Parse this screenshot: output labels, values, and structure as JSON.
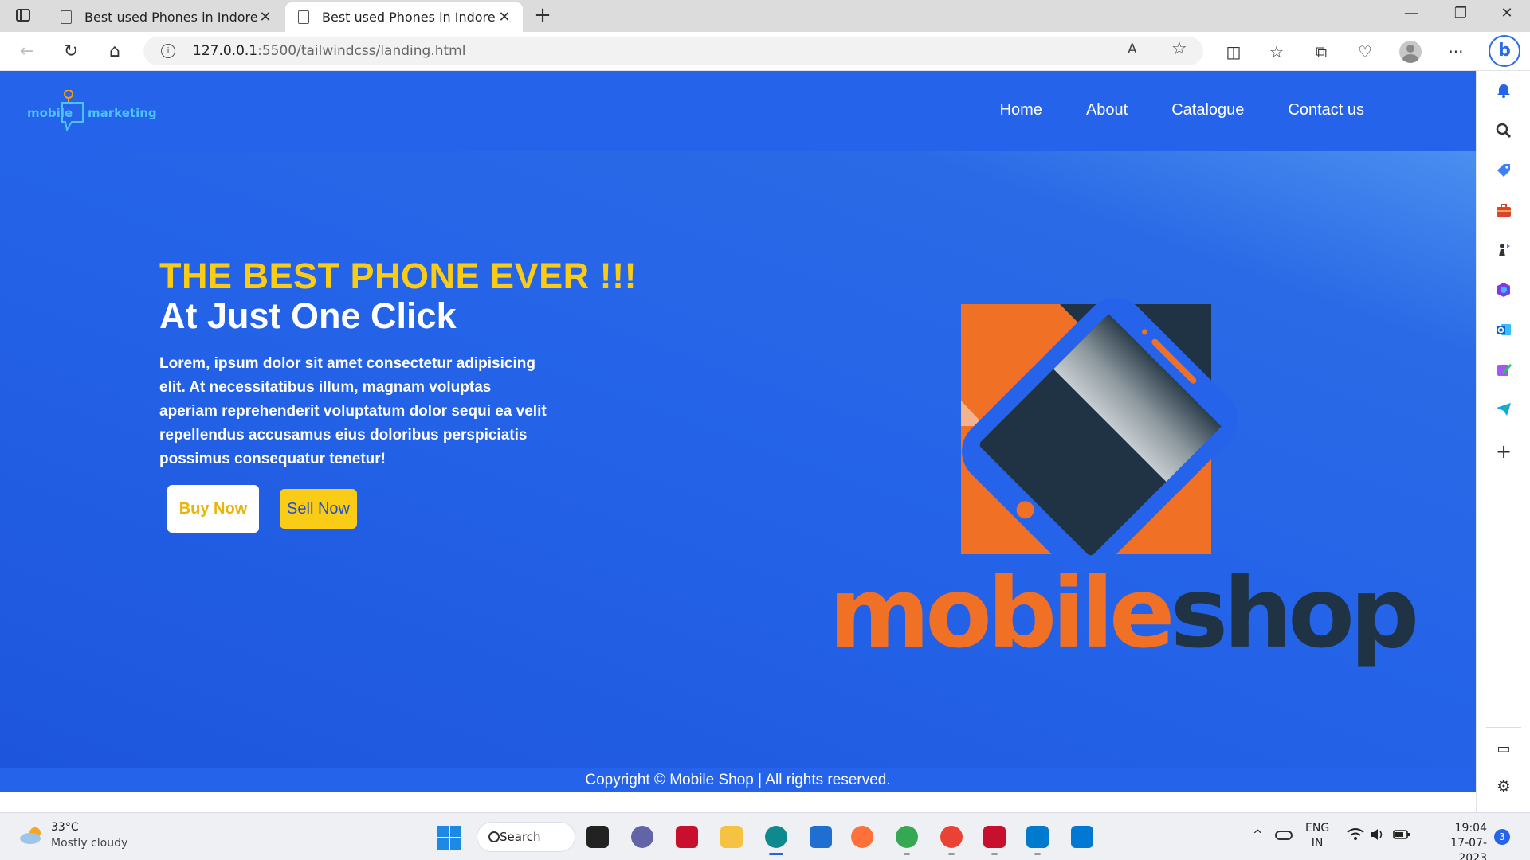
{
  "browser": {
    "tabs": [
      {
        "label": "Best used Phones in Indore",
        "close": "✕"
      },
      {
        "label": "Best used Phones in Indore",
        "close": "✕"
      }
    ],
    "new_tab": "+",
    "window": {
      "minimize": "—",
      "maximize": "❐",
      "close": "✕"
    },
    "nav": {
      "back": "←",
      "reload": "↻",
      "home": "⌂"
    },
    "url": {
      "host": "127.0.0.1",
      "rest": ":5500/tailwindcss/landing.html",
      "info": "i"
    },
    "read_aloud": "A",
    "favorite": "☆",
    "toolbar": {
      "split": "◫",
      "favorites": "☆",
      "collections": "⧉",
      "performance": "♡",
      "menu": "···"
    },
    "bing": "b"
  },
  "sidebar": {
    "icons": [
      "bell-icon",
      "search-icon",
      "shopping-icon",
      "tools-icon",
      "games-icon",
      "microsoft365-icon",
      "outlook-icon",
      "designer-icon",
      "telegram-icon"
    ],
    "add": "+",
    "bottom": {
      "panel": "▭",
      "settings": "⚙"
    }
  },
  "site": {
    "logo": {
      "left": "mobile",
      "right": "marketing"
    },
    "nav": [
      "Home",
      "About",
      "Catalogue",
      "Contact us"
    ],
    "hero": {
      "headline": "THE BEST PHONE EVER !!!",
      "subheadline": "At Just One Click",
      "paragraph": "Lorem, ipsum dolor sit amet consectetur adipisicing elit. At necessitatibus illum, magnam voluptas aperiam reprehenderit voluptatum dolor sequi ea velit repellendus accusamus eius doloribus perspiciatis possimus consequatur tenetur!",
      "buy_button": "Buy Now",
      "sell_button": "Sell Now",
      "brand": {
        "part1": "mobile",
        "part2": "shop"
      }
    },
    "footer": "Copyright © Mobile Shop | All rights reserved."
  },
  "taskbar": {
    "weather": {
      "temp": "33°C",
      "desc": "Mostly cloudy"
    },
    "search": "Search",
    "apps": [
      "task-view-icon",
      "teams-icon",
      "mcafee-icon",
      "file-explorer-icon",
      "edge-icon",
      "store-icon",
      "firefox-icon",
      "chrome-profile-icon",
      "chrome-icon",
      "mcafee-icon",
      "vscode-icon",
      "photos-icon"
    ],
    "tray": {
      "chevron": "^",
      "lang1": "ENG",
      "lang2": "IN",
      "time": "19:04",
      "date": "17-07-2023",
      "notifications": "3"
    }
  },
  "colors": {
    "header": "#2563eb",
    "accent_yellow": "#facc15",
    "brand_orange": "#f07025",
    "brand_dark": "#1f3344"
  }
}
